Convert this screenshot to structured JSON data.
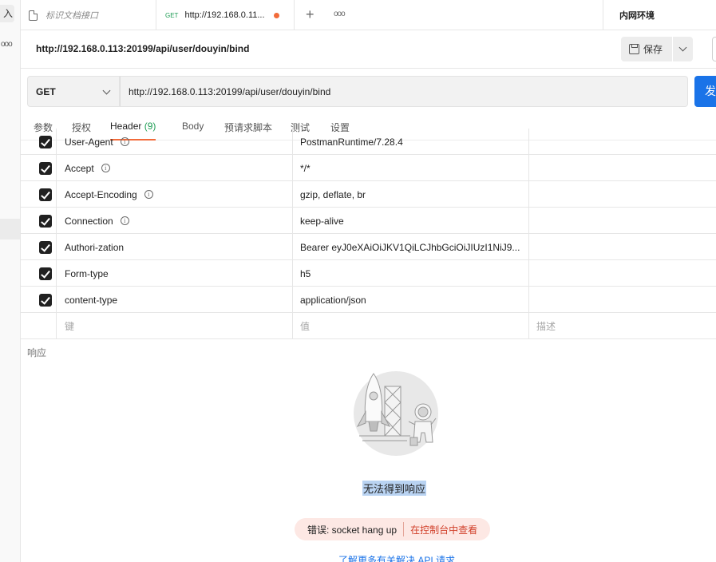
{
  "left_strip": {
    "import_label": "入",
    "more_label": "ooo"
  },
  "tabs": [
    {
      "label": "标识文档接口"
    },
    {
      "method": "GET",
      "label": "http://192.168.0.11..."
    }
  ],
  "tab_more_label": "ooo",
  "environment": {
    "label": "内网环境"
  },
  "request": {
    "title": "http://192.168.0.113:20199/api/user/douyin/bind",
    "save_label": "保存",
    "method": "GET",
    "url": "http://192.168.0.113:20199/api/user/douyin/bind",
    "send_label": "发送"
  },
  "subtabs": [
    {
      "label": "参数"
    },
    {
      "label": "授权"
    },
    {
      "label": "Header",
      "count": "(9)"
    },
    {
      "label": "Body"
    },
    {
      "label": "预请求脚本"
    },
    {
      "label": "测试"
    },
    {
      "label": "设置"
    }
  ],
  "headers": {
    "rows": [
      {
        "key": "User-Agent",
        "value": "PostmanRuntime/7.28.4",
        "checked": true,
        "info": true
      },
      {
        "key": "Accept",
        "value": "*/*",
        "checked": true,
        "info": true
      },
      {
        "key": "Accept-Encoding",
        "value": "gzip, deflate, br",
        "checked": true,
        "info": true
      },
      {
        "key": "Connection",
        "value": "keep-alive",
        "checked": true,
        "info": true
      },
      {
        "key": "Authori-zation",
        "value": "Bearer eyJ0eXAiOiJKV1QiLCJhbGciOiJIUzI1NiJ9...",
        "checked": true,
        "info": false
      },
      {
        "key": "Form-type",
        "value": "h5",
        "checked": true,
        "info": false
      },
      {
        "key": "content-type",
        "value": "application/json",
        "checked": true,
        "info": false
      }
    ],
    "placeholder_key": "键",
    "placeholder_value": "值",
    "placeholder_desc": "描述"
  },
  "response": {
    "label": "响应",
    "no_response": "无法得到响应",
    "error_message": "错误: socket hang up",
    "console_link": "在控制台中查看",
    "learn_more": "了解更多有关解决 API 请求"
  },
  "colors": {
    "accent_orange": "#f26b3a",
    "send_blue": "#1a73e8",
    "get_green": "#1f9d55",
    "error_red": "#d1412b"
  }
}
